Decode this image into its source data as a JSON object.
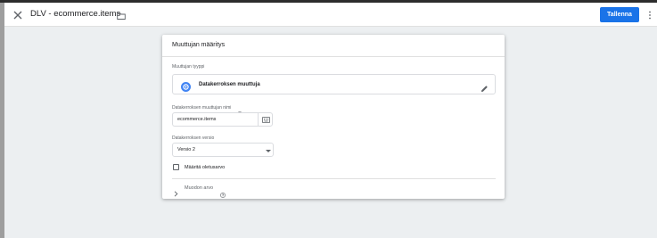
{
  "header": {
    "title": "DLV - ecommerce.items",
    "save_label": "Tallenna",
    "close_icon": "close-icon",
    "folder_icon": "folder-icon",
    "more_icon": "more-vert-icon"
  },
  "card": {
    "title": "Muuttujan määritys",
    "type_label": "Muuttujan tyyppi",
    "type_value": "Datakerroksen muuttuja",
    "name_label": "Datakerroksen muuttujan nimi",
    "name_value": "ecommerce.items",
    "version_label": "Datakerroksen versio",
    "version_value": "Versio 2",
    "default_checkbox_label": "Määritä oletusarvo",
    "default_checked": false,
    "format_label": "Muodon arvo"
  },
  "colors": {
    "accent": "#1a73e8",
    "topstrip": "#2d2d2d",
    "background": "#eceff1"
  }
}
